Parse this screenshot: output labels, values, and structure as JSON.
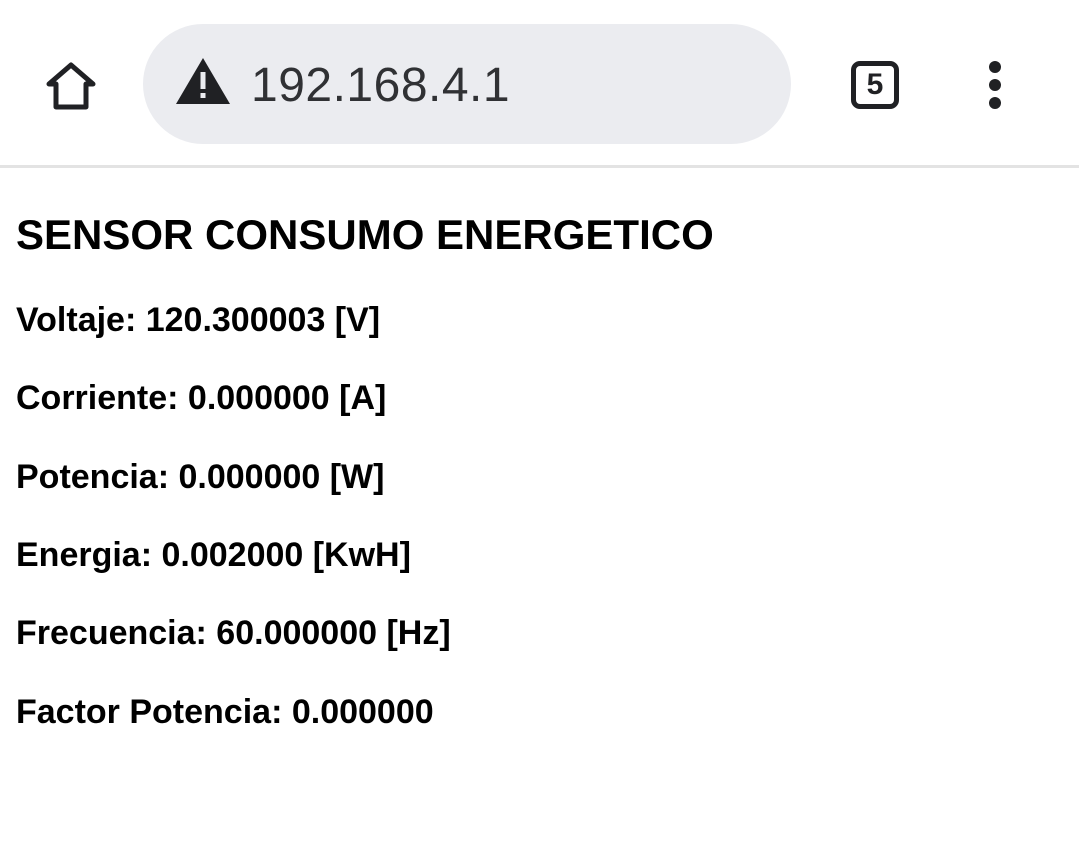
{
  "browser": {
    "url": "192.168.4.1",
    "tab_count": "5",
    "icons": {
      "home": "home-icon",
      "security": "warning-icon",
      "menu": "more-vert-icon"
    }
  },
  "page": {
    "title": "SENSOR CONSUMO ENERGETICO",
    "readings": [
      "Voltaje: 120.300003 [V]",
      "Corriente: 0.000000 [A]",
      "Potencia: 0.000000 [W]",
      "Energia: 0.002000 [KwH]",
      "Frecuencia: 60.000000 [Hz]",
      "Factor Potencia: 0.000000"
    ]
  }
}
